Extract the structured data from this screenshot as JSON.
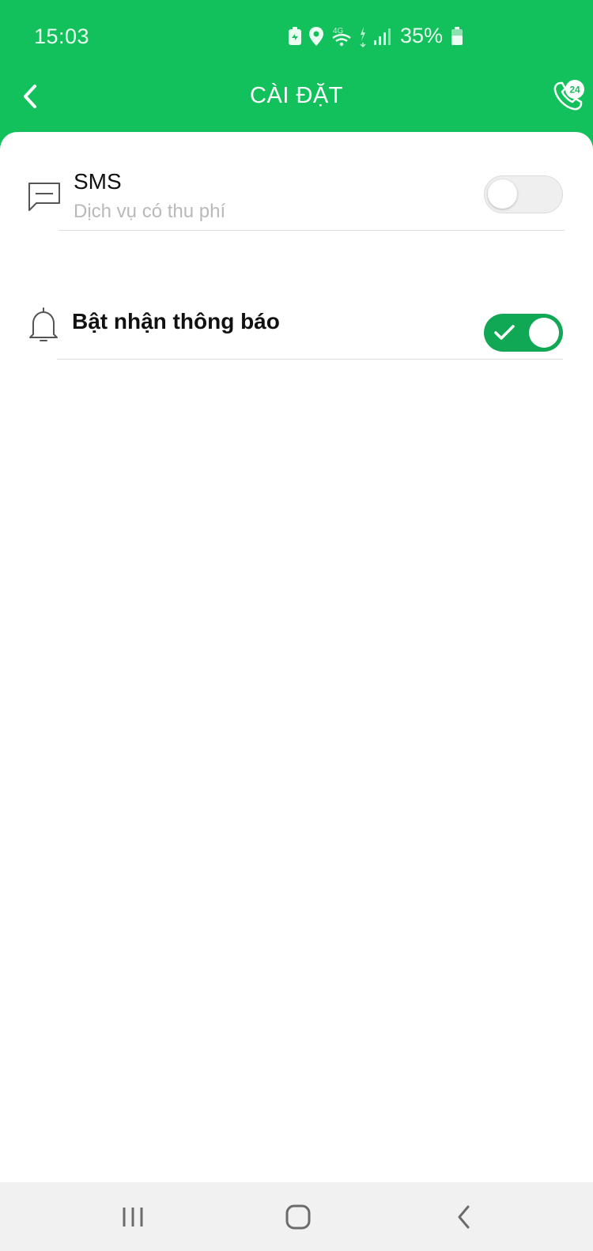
{
  "status_bar": {
    "time": "15:03",
    "battery_percent": "35%",
    "network_label": "4G",
    "icons": [
      "battery-saver-icon",
      "location-icon",
      "wifi-4g-icon",
      "signal-icon",
      "battery-icon"
    ]
  },
  "header": {
    "title": "CÀI ĐẶT",
    "back_icon": "chevron-left-icon",
    "hotline_icon": "phone-24-icon",
    "hotline_badge": "24"
  },
  "settings": {
    "sms": {
      "icon": "message-icon",
      "title": "SMS",
      "subtitle": "Dịch vụ có thu phí",
      "enabled": false
    },
    "notifications": {
      "icon": "bell-icon",
      "title": "Bật nhận thông báo",
      "enabled": true
    }
  },
  "nav_bar": {
    "items": [
      "recent-apps-icon",
      "home-icon",
      "back-icon"
    ]
  },
  "colors": {
    "brand_green": "#12c15b",
    "toggle_on": "#11a855",
    "subtitle_gray": "#b9b9b9"
  }
}
